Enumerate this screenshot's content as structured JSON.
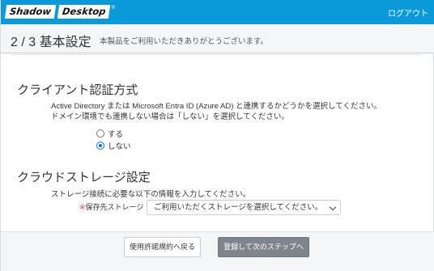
{
  "header": {
    "logo_word1": "Shadow",
    "logo_word2": "Desktop",
    "logo_reg": "®",
    "logout_label": "ログアウト"
  },
  "step": {
    "title": "2 / 3 基本設定",
    "subtitle": "本製品をご利用いただきありがとうございます。"
  },
  "auth_section": {
    "title": "クライアント認証方式",
    "desc_line1": "Active Directory または Microsoft Entra ID (Azure AD) と連携するかどうかを選択してください。",
    "desc_line2": "ドメイン環境でも連携しない場合は「しない」を選択してください。",
    "options": [
      {
        "label": "する",
        "checked": false
      },
      {
        "label": "しない",
        "checked": true
      }
    ]
  },
  "storage_section": {
    "title": "クラウドストレージ設定",
    "desc": "ストレージ接続に必要な以下の情報を入力してください。",
    "required_mark": "※",
    "field_label": "保存先ストレージ",
    "select_value": "ご利用いただくストレージを選択してください。"
  },
  "footer": {
    "back_label": "使用許諾規約へ戻る",
    "next_label": "登録して次のステップへ"
  },
  "colors": {
    "topbar": "#0a99d9",
    "accent": "#0a6fd6",
    "next_button": "#7e858c"
  }
}
